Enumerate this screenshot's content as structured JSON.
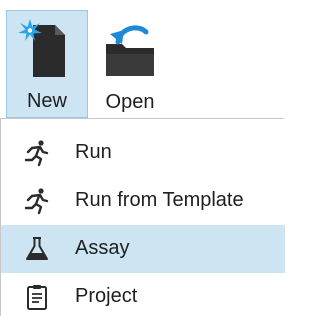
{
  "toolbar": {
    "new": {
      "label": "New",
      "icon": "new-document-icon",
      "state": "active"
    },
    "open": {
      "label": "Open",
      "icon": "open-folder-icon"
    }
  },
  "menu": {
    "items": [
      {
        "label": "Run",
        "icon": "run-icon"
      },
      {
        "label": "Run from Template",
        "icon": "run-template-icon"
      },
      {
        "label": "Assay",
        "icon": "flask-icon",
        "selected": true
      },
      {
        "label": "Project",
        "icon": "clipboard-icon"
      }
    ]
  },
  "colors": {
    "highlight": "#cde4f3",
    "highlight_border": "#9cc6e5",
    "icon_dark": "#2b2b2b",
    "accent_blue": "#1e8ad6",
    "text": "#1f1f1f"
  }
}
